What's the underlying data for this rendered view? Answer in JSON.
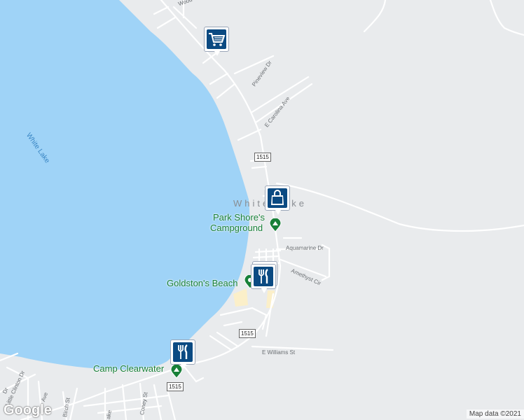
{
  "map": {
    "water_label": "White Lake",
    "town_label": "White Lake",
    "roads": {
      "woodland": "Wood",
      "pineview": "Pineview Dr",
      "carolina": "E Carolina Ave",
      "aquamarine": "Aquamarine Dr",
      "amethyst": "Amethyst Cir",
      "williams": "E Williams St",
      "little_clinton": "Little Clinton Dr",
      "birch": "Birch St",
      "conev": "Coney St",
      "ave": "Ave",
      "left_dr": "Dr",
      "lake": "ake"
    },
    "route_shields": [
      "1515",
      "1515",
      "1515"
    ],
    "pois": {
      "park_shore_line1": "Park Shore's",
      "park_shore_line2": "Campground",
      "goldstons": "Goldston's Beach",
      "camp_clearwater": "Camp Clearwater"
    },
    "markers": [
      {
        "name": "shopping-cart-marker",
        "icon": "shopping-cart-icon"
      },
      {
        "name": "shopping-bag-marker",
        "icon": "shopping-bag-icon"
      },
      {
        "name": "restaurant-marker-1",
        "icon": "fork-knife-icon"
      },
      {
        "name": "restaurant-marker-2",
        "icon": "fork-knife-icon"
      }
    ],
    "colors": {
      "water": "#9fd3f7",
      "land": "#e9ebed",
      "road": "#ffffff",
      "poi": "#188038",
      "marker": "#0b4a82",
      "beach": "#fbefc9"
    }
  },
  "footer": {
    "logo": "Google",
    "attribution": "Map data ©2021"
  }
}
